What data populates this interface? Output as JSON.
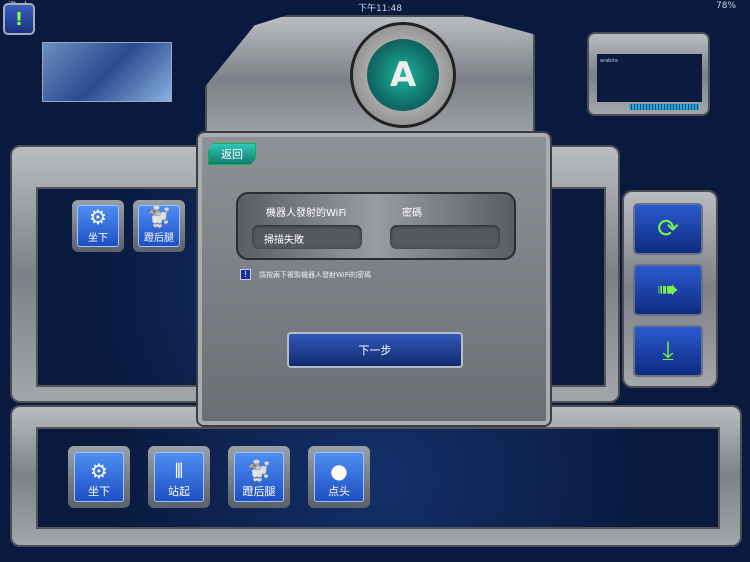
{
  "status_bar": {
    "device": "iPad",
    "time": "下午11:48",
    "battery": "78%"
  },
  "alert_button": {
    "label": "!"
  },
  "logo": {
    "letter": "A"
  },
  "video_panel": {
    "caption": "arabira"
  },
  "dialog": {
    "back_label": "返回",
    "wifi_label": "機器人發射的WiFi",
    "wifi_value": "掃描失敗",
    "password_label": "密碼",
    "password_value": "",
    "notice_icon": "!",
    "notice_text": "請按兩下複製機器人發射WiFi的密碼",
    "next_label": "下一步"
  },
  "top_actions": [
    {
      "label": "坐下",
      "icon": "robot-arm-icon"
    },
    {
      "label": "蹬后腿",
      "icon": "dog-icon"
    }
  ],
  "bottom_actions": [
    {
      "label": "坐下",
      "icon": "robot-arm-icon"
    },
    {
      "label": "站起",
      "icon": "legs-icon"
    },
    {
      "label": "蹬后腿",
      "icon": "dog-icon"
    },
    {
      "label": "点头",
      "icon": "ball-icon"
    }
  ],
  "side_buttons": [
    {
      "icon": "refresh-icon",
      "glyph": "⟳"
    },
    {
      "icon": "arrow-right-icon",
      "glyph": "➠"
    },
    {
      "icon": "download-icon",
      "glyph": "⤓"
    }
  ],
  "colors": {
    "background": "#0a1a3e",
    "accent_teal": "#1ea89a",
    "button_blue": "#2a5bd0",
    "icon_green": "#7cf04a"
  }
}
